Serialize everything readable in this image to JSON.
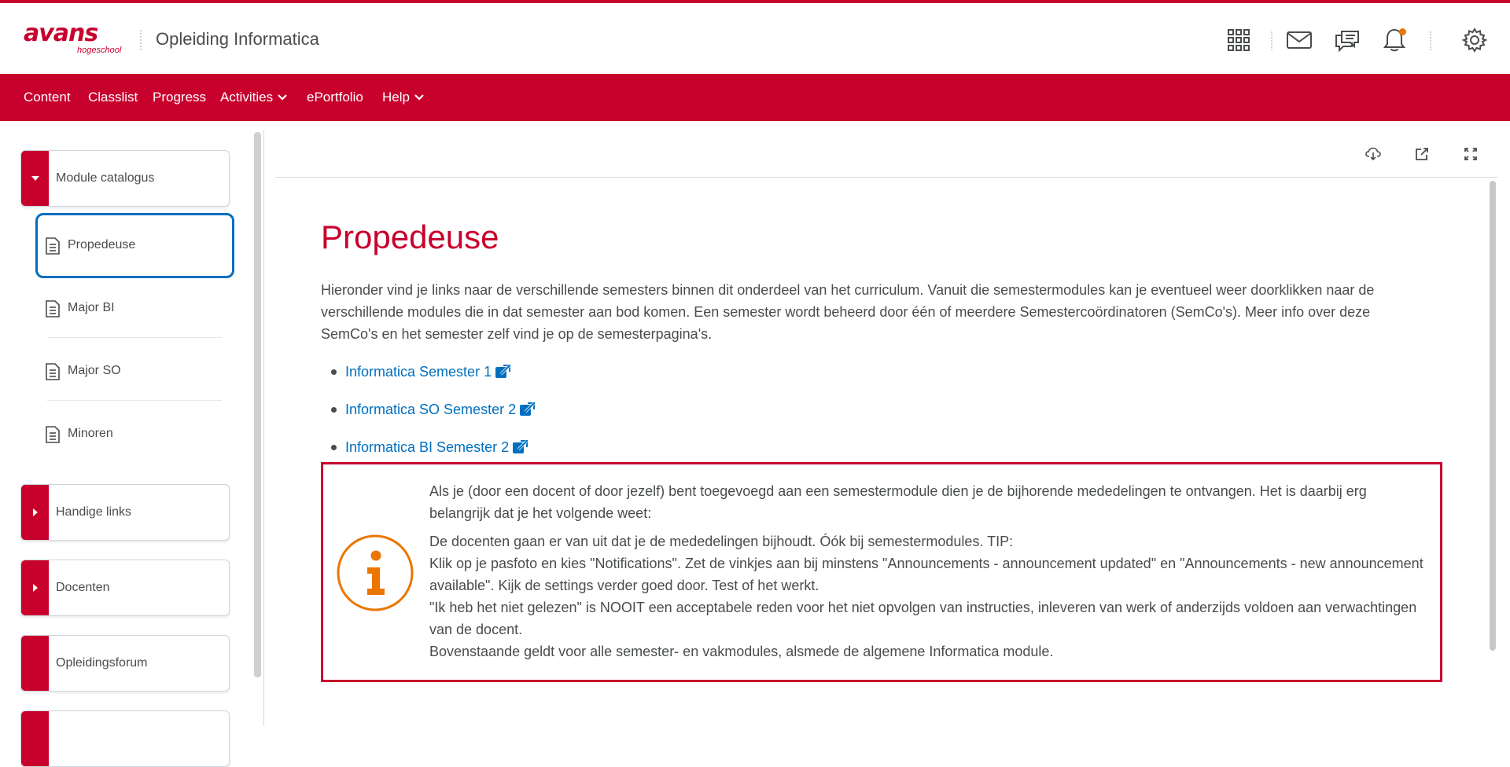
{
  "header": {
    "logo_main": "avans",
    "logo_sub": "hogeschool",
    "org_title": "Opleiding Informatica",
    "icons": [
      "apps-grid-icon",
      "mail-icon",
      "chat-icon",
      "bell-icon",
      "gear-icon"
    ],
    "accent": "#c8002c",
    "notification_dot_color": "#ea7600"
  },
  "nav": {
    "items": [
      {
        "label": "Content"
      },
      {
        "label": "Classlist"
      },
      {
        "label": "Progress"
      },
      {
        "label": "Activities"
      },
      {
        "label": "ePortfolio"
      },
      {
        "label": "Help"
      }
    ]
  },
  "sidebar": {
    "modules": [
      {
        "label": "Module catalogus",
        "expanded": true
      },
      {
        "label": "Handige links",
        "expanded": false
      },
      {
        "label": "Docenten",
        "expanded": false
      },
      {
        "label": "Opleidingsforum"
      }
    ],
    "topics": [
      {
        "label": "Propedeuse",
        "selected": true
      },
      {
        "label": "Major BI"
      },
      {
        "label": "Major SO"
      },
      {
        "label": "Minoren"
      }
    ]
  },
  "toolbar": {
    "icons": [
      "cloud-download-icon",
      "open-external-icon",
      "fullscreen-icon"
    ]
  },
  "content": {
    "title": "Propedeuse",
    "intro": "Hieronder vind je links naar de verschillende semesters binnen dit onderdeel van het curriculum. Vanuit die semestermodules kan je eventueel weer doorklikken naar de verschillende modules die in dat semester aan bod komen. Een semester wordt beheerd door één of meerdere Semestercoördinatoren (SemCo's). Meer info over deze SemCo's en het semester zelf vind je op de semesterpagina's.",
    "links": [
      {
        "label": "Informatica Semester 1"
      },
      {
        "label": "Informatica SO Semester 2"
      },
      {
        "label": "Informatica BI Semester 2"
      }
    ],
    "link_color": "#006fbf",
    "info": {
      "para1": "Als je (door een docent of door jezelf) bent toegevoegd aan een semestermodule dien je de bijhorende mededelingen te ontvangen. Het is daarbij erg belangrijk dat je het volgende weet:",
      "line1": "De docenten gaan er van uit dat je de mededelingen bijhoudt. Óók bij semestermodules. TIP:",
      "line2": "Klik op je pasfoto en kies \"Notifications\". Zet de vinkjes aan bij minstens \"Announcements - announcement updated\" en \"Announcements - new announcement available\". Kijk de settings verder goed door. Test of het werkt.",
      "line3": "\"Ik heb het niet gelezen\" is NOOIT een acceptabele reden voor het niet opvolgen van instructies, inleveren van werk of anderzijds voldoen aan verwachtingen van de docent.",
      "line4": "Bovenstaande geldt voor alle semester- en vakmodules, alsmede de algemene Informatica module.",
      "icon_letter": "i",
      "icon_color": "#ea7600"
    }
  }
}
